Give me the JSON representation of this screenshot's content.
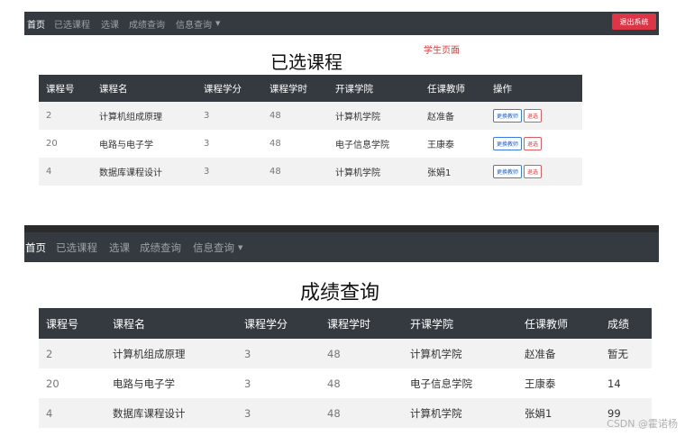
{
  "nav": {
    "home": "首页",
    "selected_courses": "已选课程",
    "choose_course": "选课",
    "grade_query": "成绩查询",
    "info_query": "信息查询",
    "logout": "退出系统"
  },
  "selected_page": {
    "title": "已选课程",
    "role_label": "学生页面",
    "headers": [
      "课程号",
      "课程名",
      "课程学分",
      "课程学时",
      "开课学院",
      "任课教师",
      "操作"
    ],
    "rows": [
      {
        "id": "2",
        "name": "计算机组成原理",
        "credit": "3",
        "hours": "48",
        "college": "计算机学院",
        "teacher": "赵准备"
      },
      {
        "id": "20",
        "name": "电路与电子学",
        "credit": "3",
        "hours": "48",
        "college": "电子信息学院",
        "teacher": "王康泰"
      },
      {
        "id": "4",
        "name": "数据库课程设计",
        "credit": "3",
        "hours": "48",
        "college": "计算机学院",
        "teacher": "张娟1"
      }
    ],
    "change_teacher_label": "更换教师",
    "drop_label": "退选"
  },
  "grade_page": {
    "title": "成绩查询",
    "headers": [
      "课程号",
      "课程名",
      "课程学分",
      "课程学时",
      "开课学院",
      "任课教师",
      "成绩"
    ],
    "rows": [
      {
        "id": "2",
        "name": "计算机组成原理",
        "credit": "3",
        "hours": "48",
        "college": "计算机学院",
        "teacher": "赵准备",
        "grade": "暂无"
      },
      {
        "id": "20",
        "name": "电路与电子学",
        "credit": "3",
        "hours": "48",
        "college": "电子信息学院",
        "teacher": "王康泰",
        "grade": "14"
      },
      {
        "id": "4",
        "name": "数据库课程设计",
        "credit": "3",
        "hours": "48",
        "college": "计算机学院",
        "teacher": "张娟1",
        "grade": "99"
      }
    ]
  },
  "watermark": "CSDN @霍诺杨",
  "colors": {
    "navbar": "#343a40",
    "logout": "#dc3545",
    "role_label": "#e0393e"
  },
  "icons": {
    "dropdown": "caret-down-icon"
  }
}
